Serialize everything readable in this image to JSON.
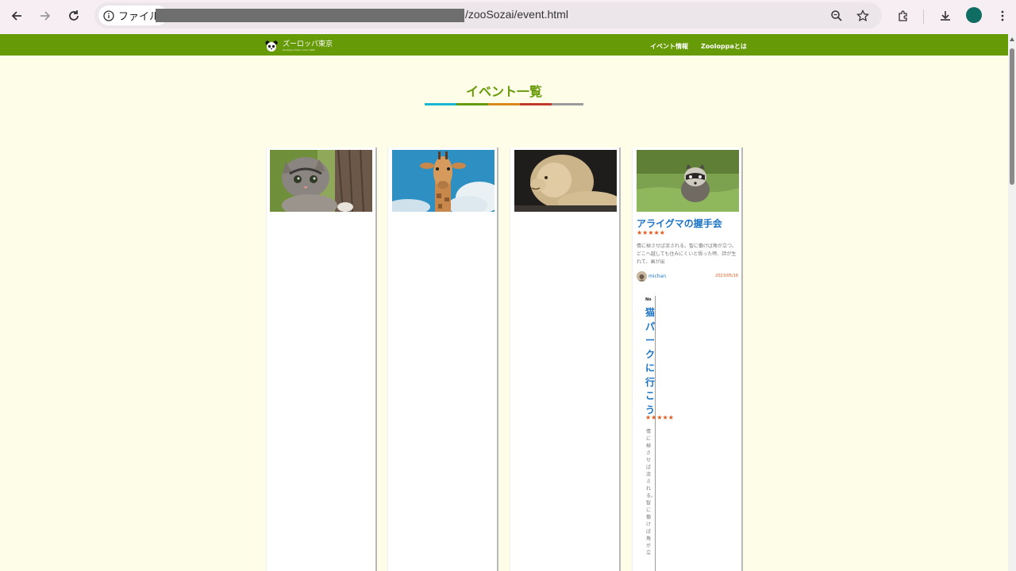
{
  "browser": {
    "site_chip_label": "ファイル",
    "url_path": "/zooSozai/event.html"
  },
  "header": {
    "logo_title": "ズーロッパ東京",
    "logo_subtitle": "Zooloppa Tokyo since 1960",
    "nav": [
      "イベント情報",
      "Zooloppaとは"
    ]
  },
  "page": {
    "title": "イベント一覧",
    "underline_colors": [
      "#1bb5d4",
      "#669a07",
      "#d98a1a",
      "#c0392b",
      "#9b9b9b"
    ]
  },
  "cards": [
    {
      "image": "kitten"
    },
    {
      "image": "giraffe"
    },
    {
      "image": "lion"
    },
    {
      "image": "raccoon",
      "title": "アライグマの握手会",
      "stars": "★★★★★",
      "description": "情に棹させば流される。智に働けば角が立つ。どこへ越しても住みにくいと悟った時、詩が生れて、画が出",
      "author": "michan",
      "date": "2023/05/16"
    }
  ],
  "vertical_card": {
    "number": "No",
    "title": "猫パークに行こう",
    "stars": "★★★★★",
    "description": "情に棹させば流される。智に働けば角が立"
  }
}
